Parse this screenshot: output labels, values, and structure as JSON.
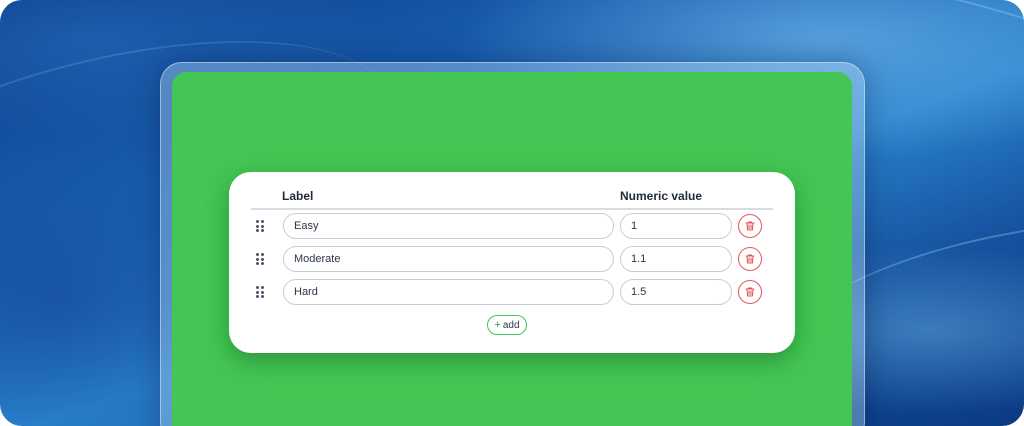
{
  "table": {
    "label_header": "Label",
    "value_header": "Numeric value",
    "rows": [
      {
        "label": "Easy",
        "value": "1"
      },
      {
        "label": "Moderate",
        "value": "1.1"
      },
      {
        "label": "Hard",
        "value": "1.5"
      }
    ],
    "add_plus": "+",
    "add_label": "add"
  },
  "icons": {
    "drag": "drag-handle-icon",
    "delete": "trash-icon"
  },
  "colors": {
    "screen": "#43c653",
    "delete": "#e4555a",
    "add_border": "#43c653"
  }
}
